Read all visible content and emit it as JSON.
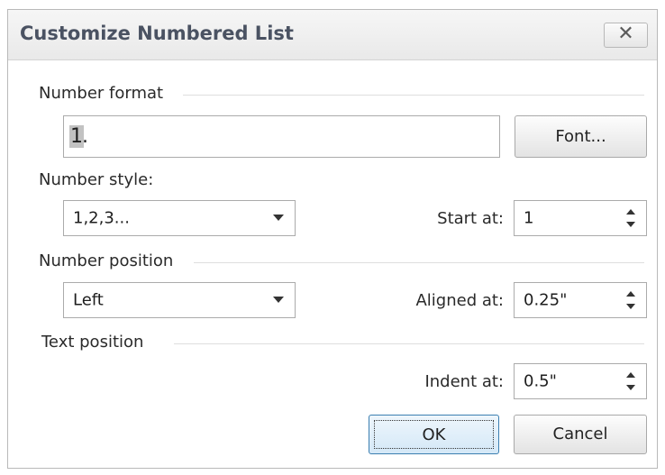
{
  "dialog": {
    "title": "Customize Numbered List",
    "close_icon": "close-icon",
    "close_glyph": "✕"
  },
  "number_format": {
    "section_label": "Number format",
    "value_highlighted": "1",
    "value_rest": ".",
    "font_button": "Font..."
  },
  "number_style": {
    "section_label": "Number style:",
    "selected": "1,2,3...",
    "start_label": "Start at:",
    "start_value": "1"
  },
  "number_position": {
    "section_label": "Number position",
    "selected": "Left",
    "aligned_label": "Aligned at:",
    "aligned_value": "0.25\""
  },
  "text_position": {
    "section_label": "Text position",
    "indent_label": "Indent at:",
    "indent_value": "0.5\""
  },
  "buttons": {
    "ok": "OK",
    "cancel": "Cancel"
  }
}
